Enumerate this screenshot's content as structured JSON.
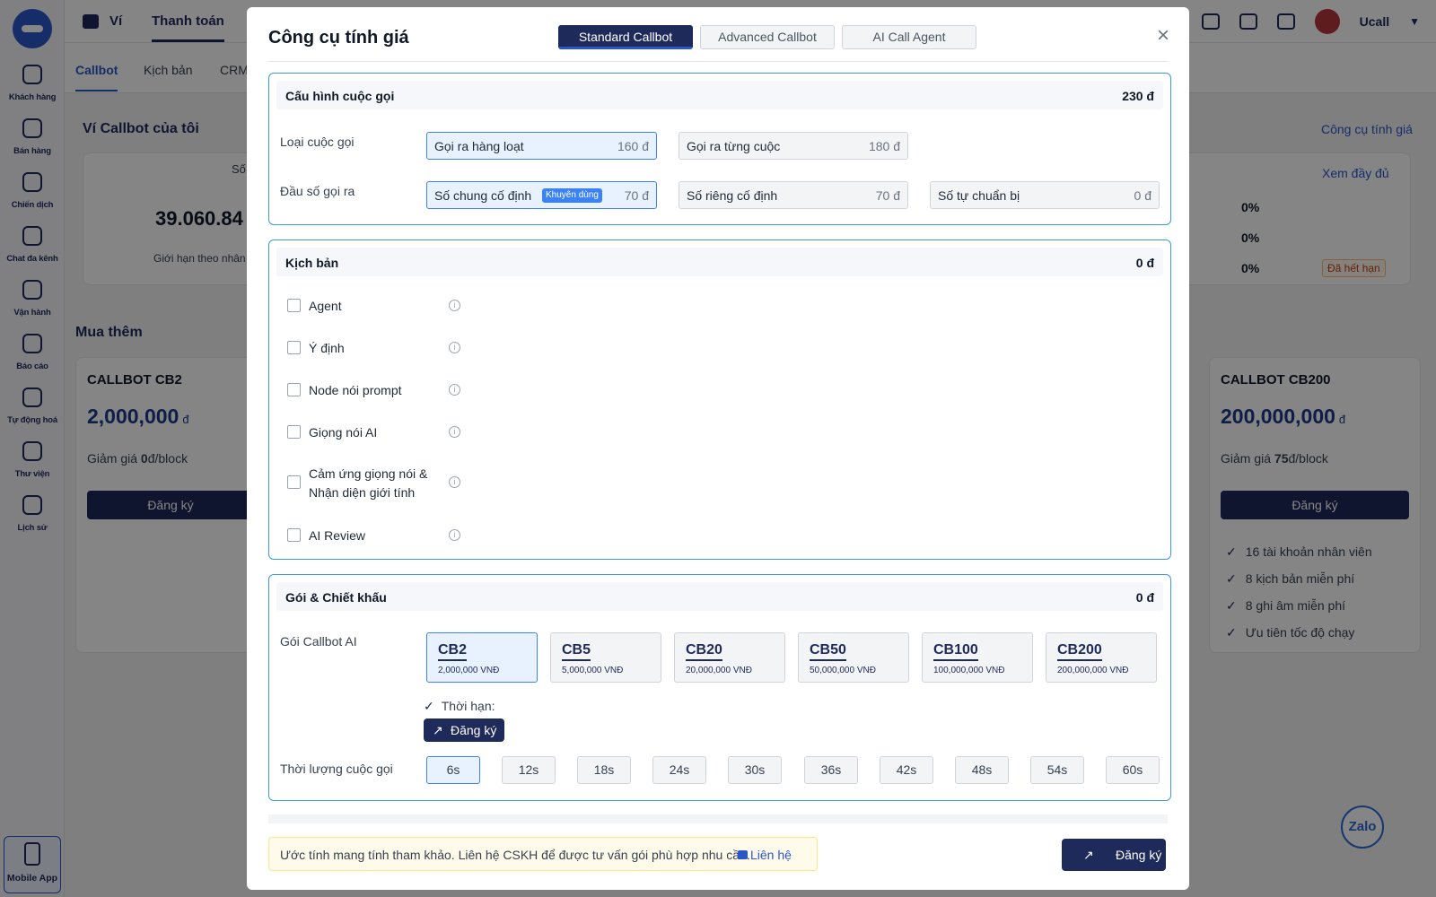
{
  "sidebar": {
    "items": [
      {
        "label": "Khách hàng",
        "icon": "contacts-icon"
      },
      {
        "label": "Bán hàng",
        "icon": "store-icon"
      },
      {
        "label": "Chiến dịch",
        "icon": "campaign-icon"
      },
      {
        "label": "Chat đa kênh",
        "icon": "chat-icon"
      },
      {
        "label": "Vận hành",
        "icon": "briefcase-icon"
      },
      {
        "label": "Báo cáo",
        "icon": "report-icon"
      },
      {
        "label": "Tự động hoá",
        "icon": "automation-icon"
      },
      {
        "label": "Thư viện",
        "icon": "library-icon"
      },
      {
        "label": "Lịch sử",
        "icon": "clock-icon"
      }
    ],
    "mobile_app": "Mobile App"
  },
  "topbar": {
    "wallet": "Ví",
    "payment": "Thanh toán",
    "user": "Ucall"
  },
  "subtabs": {
    "callbot": "Callbot",
    "script": "Kịch bản",
    "crm": "CRM"
  },
  "background": {
    "wallet_title": "Ví Callbot của tôi",
    "balance_prefix": "Số",
    "balance": "39.060.84",
    "limit_text": "Giới hạn theo nhân v",
    "pricing_tool_link": "Công cụ tính giá",
    "view_full": "Xem đầy đủ",
    "percents": [
      "0%",
      "0%",
      "0%"
    ],
    "expired": "Đã hết hạn",
    "buy_more": "Mua thêm",
    "pack_left": {
      "name": "CALLBOT CB2",
      "price": "2,000,000",
      "unit": "đ",
      "discount_prefix": "Giảm giá ",
      "discount_value": "0",
      "discount_suffix": "đ/block",
      "button": "Đăng ký"
    },
    "pack_right": {
      "name": "CALLBOT CB200",
      "price": "200,000,000",
      "unit": "đ",
      "discount_prefix": "Giảm giá ",
      "discount_value": "75",
      "discount_suffix": "đ/block",
      "button": "Đăng ký",
      "features": [
        "16 tài khoản nhân viên",
        "8 kịch bản miễn phí",
        "8 ghi âm miễn phí",
        "Ưu tiên tốc độ chạy"
      ]
    }
  },
  "modal": {
    "title": "Công cụ tính giá",
    "tabs": [
      "Standard Callbot",
      "Advanced Callbot",
      "AI Call Agent"
    ],
    "active_tab": 0,
    "close": "×",
    "call_config": {
      "title": "Cấu hình cuộc gọi",
      "price": "230 đ",
      "call_type_label": "Loại cuộc gọi",
      "call_type_options": [
        {
          "label": "Gọi ra hàng loạt",
          "price": "160 đ",
          "active": true
        },
        {
          "label": "Gọi ra từng cuộc",
          "price": "180 đ",
          "active": false
        }
      ],
      "number_label": "Đầu số gọi ra",
      "number_options": [
        {
          "label": "Số chung cố định",
          "price": "70 đ",
          "active": true,
          "badge": "Khuyên dùng"
        },
        {
          "label": "Số riêng cố định",
          "price": "70 đ",
          "active": false
        },
        {
          "label": "Số tự chuẩn bị",
          "price": "0 đ",
          "active": false
        }
      ]
    },
    "script": {
      "title": "Kịch bản",
      "price": "0 đ",
      "options": [
        "Agent",
        "Ý định",
        "Node nói prompt",
        "Giọng nói AI",
        "Cảm ứng giọng nói &",
        "AI Review"
      ],
      "option_line2": "Nhận diện giới tính",
      "info_icon": "i"
    },
    "package": {
      "title": "Gói & Chiết khấu",
      "price": "0 đ",
      "pkg_label": "Gói Callbot AI",
      "packages": [
        {
          "name": "CB2",
          "price": "2,000,000 VNĐ"
        },
        {
          "name": "CB5",
          "price": "5,000,000 VNĐ"
        },
        {
          "name": "CB20",
          "price": "20,000,000 VNĐ"
        },
        {
          "name": "CB50",
          "price": "50,000,000 VNĐ"
        },
        {
          "name": "CB100",
          "price": "100,000,000 VNĐ"
        },
        {
          "name": "CB200",
          "price": "200,000,000 VNĐ"
        }
      ],
      "active_package": 0,
      "term_label": "Thời hạn:",
      "register": "Đăng ký",
      "duration_label": "Thời lượng cuộc gọi",
      "durations": [
        "6s",
        "12s",
        "18s",
        "24s",
        "30s",
        "36s",
        "42s",
        "48s",
        "54s",
        "60s"
      ],
      "active_duration": 0
    },
    "note": "Ước tính mang tính tham khảo. Liên hệ CSKH để được tư vấn gói phù hợp nhu cầu.",
    "contact": "Liên hệ",
    "cta": "Đăng ký"
  },
  "zalo": "Zalo",
  "colors": {
    "primary": "#1e2a5a",
    "accent": "#3b82f6",
    "border": "#3b9ae1"
  }
}
